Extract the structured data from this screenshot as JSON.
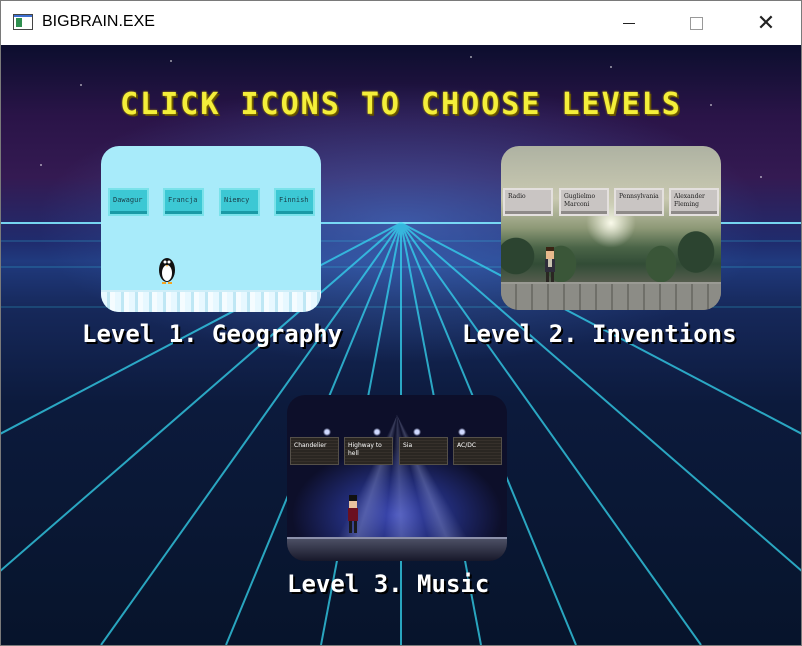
{
  "window": {
    "title": "BIGBRAIN.EXE",
    "controls": {
      "minimize": "minimize",
      "maximize": "maximize",
      "close": "close"
    }
  },
  "headline": "CLICK ICONS TO CHOOSE LEVELS",
  "levels": [
    {
      "label": "Level 1. Geography",
      "choices": [
        "Dawagur",
        "Francja",
        "Niemcy",
        "Finnish"
      ]
    },
    {
      "label": "Level 2. Inventions",
      "choices": [
        "Radio",
        "Guglielmo Marconi",
        "Pennsylvania",
        "Alexander Fleming"
      ]
    },
    {
      "label": "Level 3. Music",
      "choices": [
        "Chandelier",
        "Highway to hell",
        "Sia",
        "AC/DC"
      ]
    }
  ],
  "colors": {
    "headline": "#f4ef3a",
    "label": "#ffffff",
    "grid_line": "#35d6f0"
  },
  "icons": {
    "app": "window-app-icon",
    "character1": "penguin-icon",
    "character2": "inventor-icon",
    "character3": "musician-icon"
  }
}
